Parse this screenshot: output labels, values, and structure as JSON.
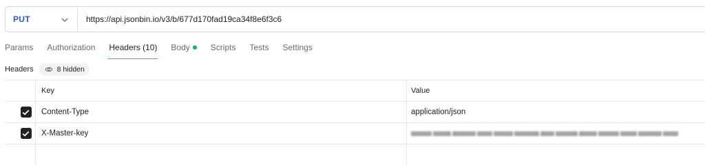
{
  "request": {
    "method": "PUT",
    "url": "https://api.jsonbin.io/v3/b/677d170fad19ca34f8e6f3c6"
  },
  "tabs": [
    {
      "label": "Params"
    },
    {
      "label": "Authorization"
    },
    {
      "label": "Headers (10)"
    },
    {
      "label": "Body"
    },
    {
      "label": "Scripts"
    },
    {
      "label": "Tests"
    },
    {
      "label": "Settings"
    }
  ],
  "active_tab": "Headers (10)",
  "body_indicator_color": "#0cbb52",
  "headers_section": {
    "label": "Headers",
    "hidden_label": "8 hidden",
    "hidden_icon": "eye-icon"
  },
  "table": {
    "columns": {
      "key": "Key",
      "value": "Value"
    },
    "rows": [
      {
        "checked": true,
        "key": "Content-Type",
        "value": "application/json"
      },
      {
        "checked": true,
        "key": "X-Master-key",
        "value": ""
      }
    ]
  },
  "colors": {
    "method": "#2f57c4",
    "active_tab_underline": "#ff6c37",
    "checkbox": "#212121"
  }
}
